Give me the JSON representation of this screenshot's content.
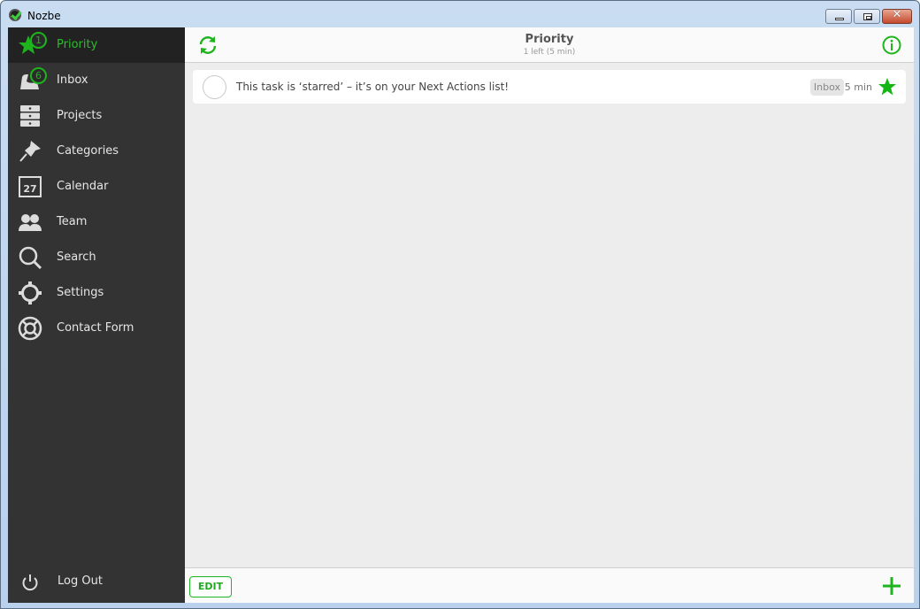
{
  "window": {
    "title": "Nozbe",
    "controls": [
      "minimize",
      "maximize",
      "close"
    ]
  },
  "colors": {
    "accent": "#1db41d",
    "sidebar_bg": "#333333",
    "sidebar_active_bg": "#222222",
    "content_bg": "#ededed"
  },
  "sidebar": {
    "items": [
      {
        "label": "Priority",
        "icon": "star-icon",
        "badge": "1",
        "active": true
      },
      {
        "label": "Inbox",
        "icon": "inbox-icon",
        "badge": "6",
        "active": false
      },
      {
        "label": "Projects",
        "icon": "projects-icon",
        "active": false
      },
      {
        "label": "Categories",
        "icon": "pin-icon",
        "active": false
      },
      {
        "label": "Calendar",
        "icon": "calendar-icon",
        "calendar_day": "27",
        "active": false
      },
      {
        "label": "Team",
        "icon": "team-icon",
        "active": false
      },
      {
        "label": "Search",
        "icon": "search-icon",
        "active": false
      },
      {
        "label": "Settings",
        "icon": "gear-icon",
        "active": false
      },
      {
        "label": "Contact Form",
        "icon": "lifebuoy-icon",
        "active": false
      }
    ],
    "logout": {
      "label": "Log Out",
      "icon": "power-icon"
    }
  },
  "header": {
    "title": "Priority",
    "subtitle": "1 left (5 min)",
    "refresh_icon": "refresh-icon",
    "info_icon": "info-icon"
  },
  "tasks": [
    {
      "text": "This task is ‘starred’ – it’s on your Next Actions list!",
      "project": "Inbox",
      "time": "5 min",
      "starred": true,
      "completed": false
    }
  ],
  "footer": {
    "edit_label": "EDIT",
    "add_icon": "plus-icon"
  }
}
